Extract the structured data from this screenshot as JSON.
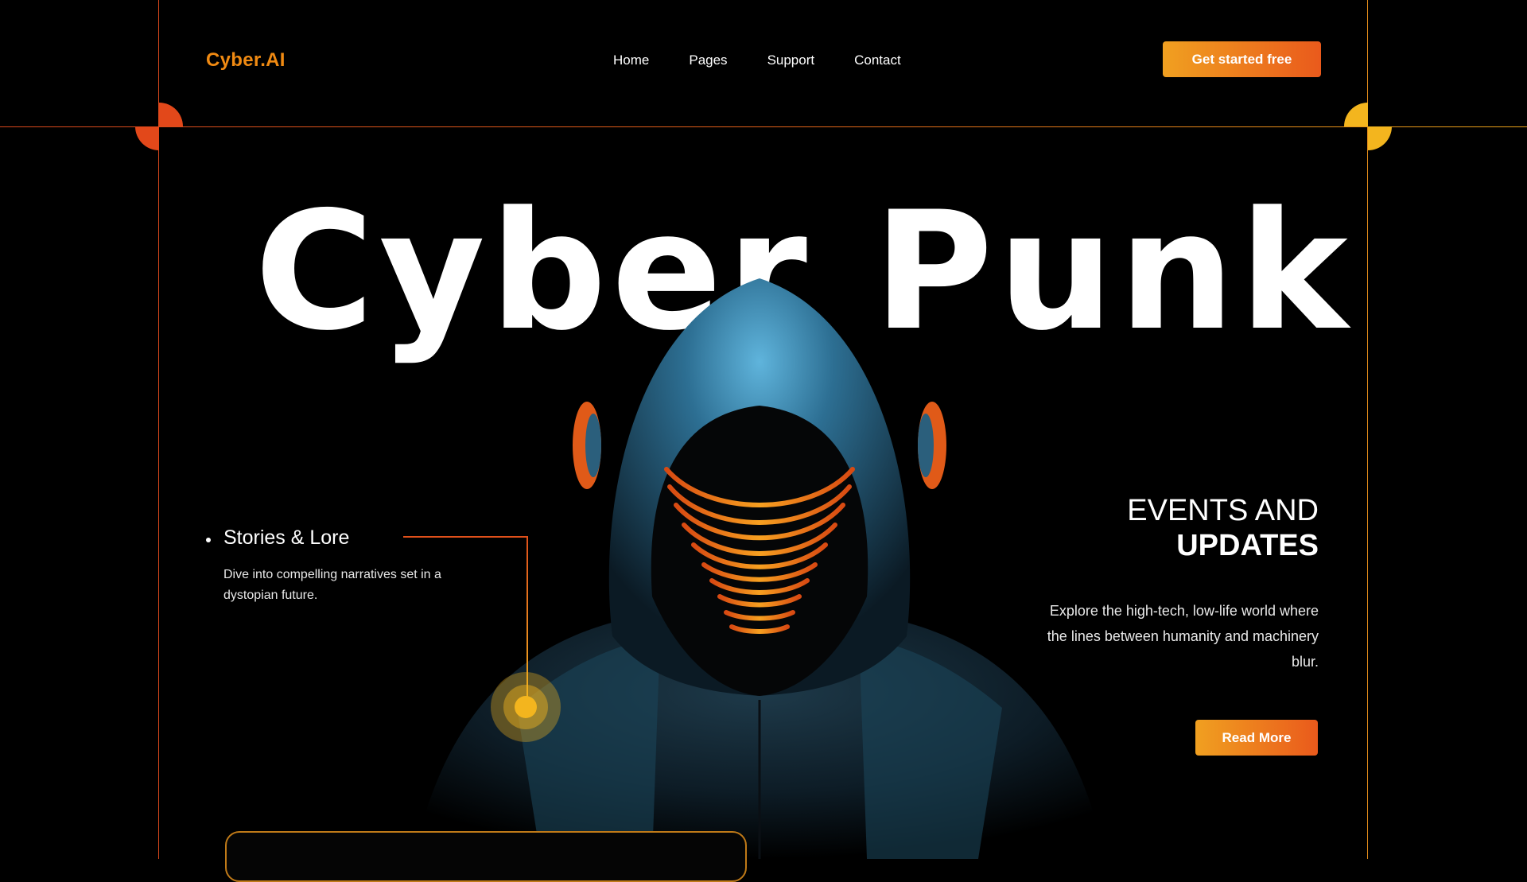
{
  "header": {
    "logo": "Cyber.AI",
    "nav": [
      "Home",
      "Pages",
      "Support",
      "Contact"
    ],
    "cta_label": "Get started free"
  },
  "hero": {
    "title": "Cyber Punk"
  },
  "stories": {
    "title": "Stories & Lore",
    "description": "Dive into compelling narratives set in a dystopian future."
  },
  "events": {
    "title_light": "EVENTS AND",
    "title_bold": "UPDATES",
    "description": "Explore the high-tech, low-life world where the lines between humanity and machinery blur.",
    "button_label": "Read More"
  },
  "colors": {
    "accent_orange": "#f08a12",
    "accent_red": "#e2481a",
    "accent_yellow": "#f3b51e",
    "background": "#000000"
  },
  "icons": {
    "figure": "hooded-cyberpunk-figure",
    "hotspot": "target-hotspot-icon"
  }
}
